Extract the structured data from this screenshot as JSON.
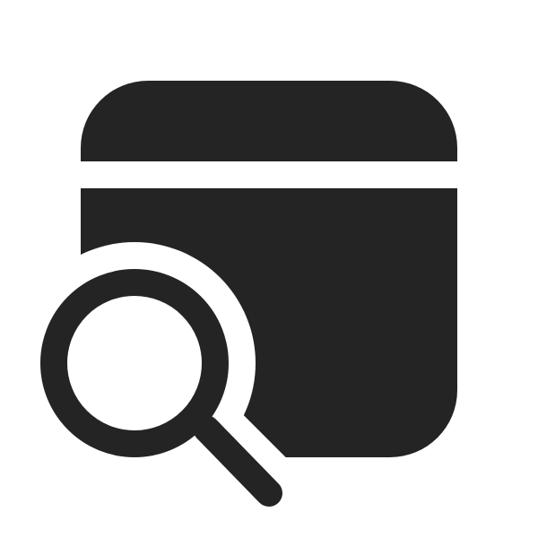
{
  "icon": {
    "name": "window-search-icon",
    "color": "#242424",
    "background": "#ffffff"
  }
}
